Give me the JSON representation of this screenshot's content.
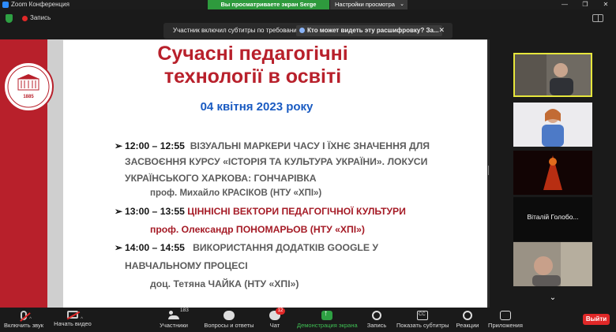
{
  "window": {
    "title": "Zoom Конференция",
    "share_banner": "Вы просматриваете экран Serge Radobuх",
    "view_options": "Настройки просмотра",
    "controls": [
      "—",
      "❐",
      "✕"
    ]
  },
  "topbar": {
    "recording_label": "Запись"
  },
  "caption_banner": {
    "message": "Участник включил субтитры по требованию",
    "who_can_see": "Кто может видеть эту расшифровку? За..."
  },
  "slide": {
    "title_line1": "Сучасні педагогічні",
    "title_line2": "технології в освіті",
    "date": "04 квітня 2023 року",
    "emblem_year": "1885",
    "agenda": [
      {
        "time": "12:00 – 12:55",
        "lines": [
          "ВІЗУАЛЬНІ МАРКЕРИ ЧАСУ І ЇХНЄ ЗНАЧЕННЯ ДЛЯ",
          "ЗАСВОЄННЯ КУРСУ «ІСТОРІЯ ТА КУЛЬТУРА УКРАЇНИ». ЛОКУСИ",
          "УКРАЇНСЬКОГО ХАРКОВА: ГОНЧАРІВКА"
        ],
        "speaker": "проф. Михайло КРАСІКОВ (НТУ «ХПІ»)"
      },
      {
        "time": "13:00 – 13:55",
        "lines": [
          "ЦІННІСНІ ВЕКТОРИ ПЕДАГОГІЧНОЇ КУЛЬТУРИ"
        ],
        "speaker": "проф. Олександр ПОНОМАРЬОВ (НТУ «ХПІ»)"
      },
      {
        "time": "14:00 – 14:55",
        "lines": [
          "ВИКОРИСТАННЯ ДОДАТКІВ GOOGLE У",
          "НАВЧАЛЬНОМУ ПРОЦЕСІ"
        ],
        "speaker": "доц. Тетяна ЧАЙКА (НТУ «ХПІ»)"
      }
    ]
  },
  "participants": {
    "name_tile": "Віталій Голобо..."
  },
  "toolbar": {
    "mic": "Включить звук",
    "video": "Начать видео",
    "participants": "Участники",
    "participants_count": "183",
    "qa": "Вопросы и ответы",
    "chat": "Чат",
    "chat_badge": "12",
    "share": "Демонстрация экрана",
    "record": "Запись",
    "captions": "Показать субтитры",
    "reactions": "Реакции",
    "apps": "Приложения",
    "leave": "Выйти"
  },
  "colors": {
    "brand_red": "#b8202b",
    "date_blue": "#1a5bc2",
    "share_green": "#2ea043",
    "leave_red": "#e02828"
  }
}
